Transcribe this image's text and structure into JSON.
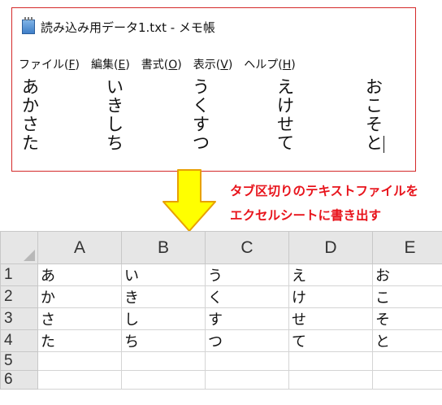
{
  "notepad": {
    "title": "読み込み用データ1.txt - メモ帳",
    "icon": "notepad-icon",
    "menus": [
      {
        "label": "ファイル(",
        "acc": "F",
        "end": ")"
      },
      {
        "label": "編集(",
        "acc": "E",
        "end": ")"
      },
      {
        "label": "書式(",
        "acc": "O",
        "end": ")"
      },
      {
        "label": "表示(",
        "acc": "V",
        "end": ")"
      },
      {
        "label": "ヘルプ(",
        "acc": "H",
        "end": ")"
      }
    ],
    "rows": [
      [
        "あ",
        "い",
        "う",
        "え",
        "お"
      ],
      [
        "か",
        "き",
        "く",
        "け",
        "こ"
      ],
      [
        "さ",
        "し",
        "す",
        "せ",
        "そ"
      ],
      [
        "た",
        "ち",
        "つ",
        "て",
        "と"
      ]
    ]
  },
  "annotation": {
    "line1": "タブ区切りのテキストファイルを",
    "line2": "エクセルシートに書き出す",
    "color": "#e8141c",
    "arrow_color": "#ffff00"
  },
  "sheet": {
    "columns": [
      "A",
      "B",
      "C",
      "D",
      "E"
    ],
    "row_numbers": [
      "1",
      "2",
      "3",
      "4",
      "5",
      "6"
    ],
    "rows": [
      [
        "あ",
        "い",
        "う",
        "え",
        "お"
      ],
      [
        "か",
        "き",
        "く",
        "け",
        "こ"
      ],
      [
        "さ",
        "し",
        "す",
        "せ",
        "そ"
      ],
      [
        "た",
        "ち",
        "つ",
        "て",
        "と"
      ],
      [
        "",
        "",
        "",
        "",
        ""
      ],
      [
        "",
        "",
        "",
        "",
        ""
      ]
    ]
  }
}
